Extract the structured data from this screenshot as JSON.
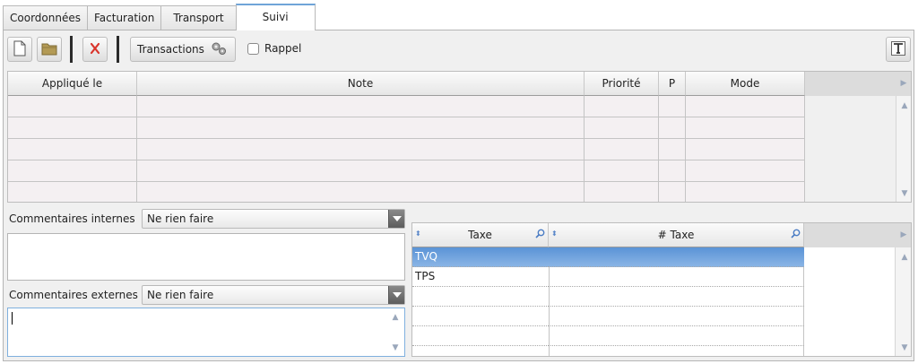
{
  "tabs": [
    {
      "label": "Coordonnées"
    },
    {
      "label": "Facturation"
    },
    {
      "label": "Transport"
    },
    {
      "label": "Suivi"
    }
  ],
  "toolbar": {
    "transactions_label": "Transactions",
    "rappel_label": "Rappel",
    "rappel_checked": false
  },
  "notes_table": {
    "columns": [
      "Appliqué le",
      "Note",
      "Priorité",
      "P",
      "Mode"
    ],
    "rows": [
      [
        "",
        "",
        "",
        "",
        ""
      ],
      [
        "",
        "",
        "",
        "",
        ""
      ],
      [
        "",
        "",
        "",
        "",
        ""
      ],
      [
        "",
        "",
        "",
        "",
        ""
      ],
      [
        "",
        "",
        "",
        "",
        ""
      ]
    ]
  },
  "internal_comments": {
    "label": "Commentaires internes",
    "action_value": "Ne rien faire"
  },
  "external_comments": {
    "label": "Commentaires externes",
    "action_value": "Ne rien faire"
  },
  "tax_table": {
    "columns": [
      "Taxe",
      "# Taxe"
    ],
    "rows": [
      {
        "taxe": "TVQ",
        "num": "",
        "selected": true
      },
      {
        "taxe": "TPS",
        "num": "",
        "selected": false
      },
      {
        "taxe": "",
        "num": "",
        "selected": false
      },
      {
        "taxe": "",
        "num": "",
        "selected": false
      },
      {
        "taxe": "",
        "num": "",
        "selected": false
      }
    ]
  },
  "colors": {
    "selection": "#5a93d6",
    "active_tab_accent": "#6fa4d8",
    "delete_x": "#d9342b"
  }
}
